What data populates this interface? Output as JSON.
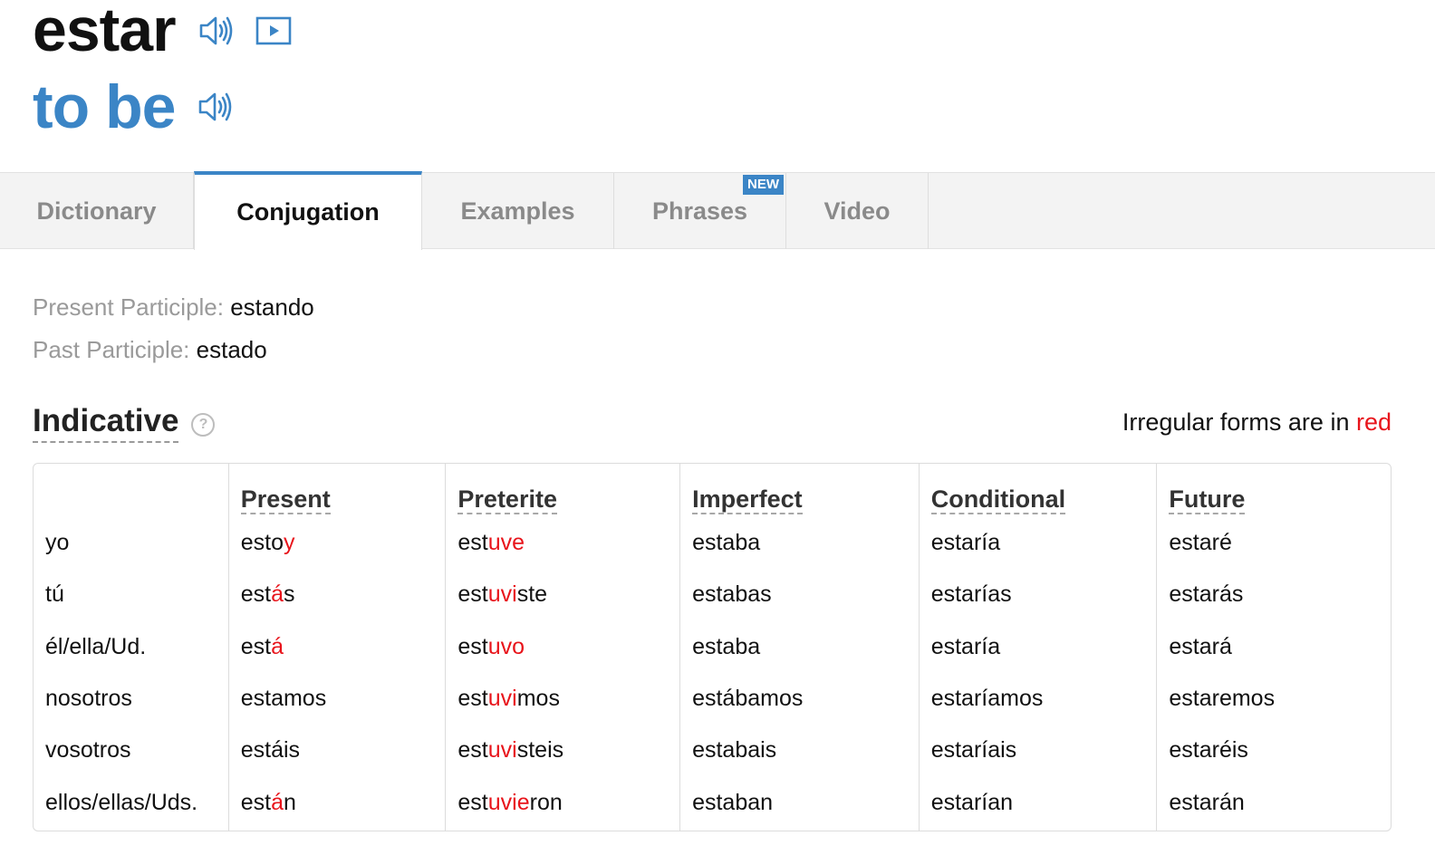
{
  "header": {
    "spanish_word": "estar",
    "english_word": "to be",
    "icons": {
      "spanish_audio": "speaker-icon",
      "video": "play-video-icon",
      "english_audio": "speaker-icon"
    }
  },
  "tabs": [
    {
      "label": "Dictionary",
      "active": false
    },
    {
      "label": "Conjugation",
      "active": true
    },
    {
      "label": "Examples",
      "active": false
    },
    {
      "label": "Phrases",
      "active": false,
      "badge": "NEW"
    },
    {
      "label": "Video",
      "active": false
    }
  ],
  "participles": {
    "present_label": "Present Participle:",
    "present_value": "estando",
    "past_label": "Past Participle:",
    "past_value": "estado"
  },
  "indicative": {
    "title": "Indicative",
    "help_icon": "?",
    "note_prefix": "Irregular forms are in ",
    "note_red": "red",
    "pronouns": [
      "yo",
      "tú",
      "él/ella/Ud.",
      "nosotros",
      "vosotros",
      "ellos/ellas/Uds."
    ],
    "tenses": [
      {
        "name": "Present",
        "forms": [
          {
            "stem": "esto",
            "irr": "y",
            "end": ""
          },
          {
            "stem": "est",
            "irr": "á",
            "end": "s"
          },
          {
            "stem": "est",
            "irr": "á",
            "end": ""
          },
          {
            "stem": "estamos",
            "irr": "",
            "end": ""
          },
          {
            "stem": "estáis",
            "irr": "",
            "end": ""
          },
          {
            "stem": "est",
            "irr": "á",
            "end": "n"
          }
        ]
      },
      {
        "name": "Preterite",
        "forms": [
          {
            "stem": "est",
            "irr": "uve",
            "end": ""
          },
          {
            "stem": "est",
            "irr": "uvi",
            "end": "ste"
          },
          {
            "stem": "est",
            "irr": "uvo",
            "end": ""
          },
          {
            "stem": "est",
            "irr": "uvi",
            "end": "mos"
          },
          {
            "stem": "est",
            "irr": "uvi",
            "end": "steis"
          },
          {
            "stem": "est",
            "irr": "uvie",
            "end": "ron"
          }
        ]
      },
      {
        "name": "Imperfect",
        "forms": [
          {
            "stem": "estaba",
            "irr": "",
            "end": ""
          },
          {
            "stem": "estabas",
            "irr": "",
            "end": ""
          },
          {
            "stem": "estaba",
            "irr": "",
            "end": ""
          },
          {
            "stem": "estábamos",
            "irr": "",
            "end": ""
          },
          {
            "stem": "estabais",
            "irr": "",
            "end": ""
          },
          {
            "stem": "estaban",
            "irr": "",
            "end": ""
          }
        ]
      },
      {
        "name": "Conditional",
        "forms": [
          {
            "stem": "estaría",
            "irr": "",
            "end": ""
          },
          {
            "stem": "estarías",
            "irr": "",
            "end": ""
          },
          {
            "stem": "estaría",
            "irr": "",
            "end": ""
          },
          {
            "stem": "estaríamos",
            "irr": "",
            "end": ""
          },
          {
            "stem": "estaríais",
            "irr": "",
            "end": ""
          },
          {
            "stem": "estarían",
            "irr": "",
            "end": ""
          }
        ]
      },
      {
        "name": "Future",
        "forms": [
          {
            "stem": "estaré",
            "irr": "",
            "end": ""
          },
          {
            "stem": "estarás",
            "irr": "",
            "end": ""
          },
          {
            "stem": "estará",
            "irr": "",
            "end": ""
          },
          {
            "stem": "estaremos",
            "irr": "",
            "end": ""
          },
          {
            "stem": "estaréis",
            "irr": "",
            "end": ""
          },
          {
            "stem": "estarán",
            "irr": "",
            "end": ""
          }
        ]
      }
    ]
  },
  "colors": {
    "accent": "#3b85c6",
    "irregular": "#e8141b"
  }
}
